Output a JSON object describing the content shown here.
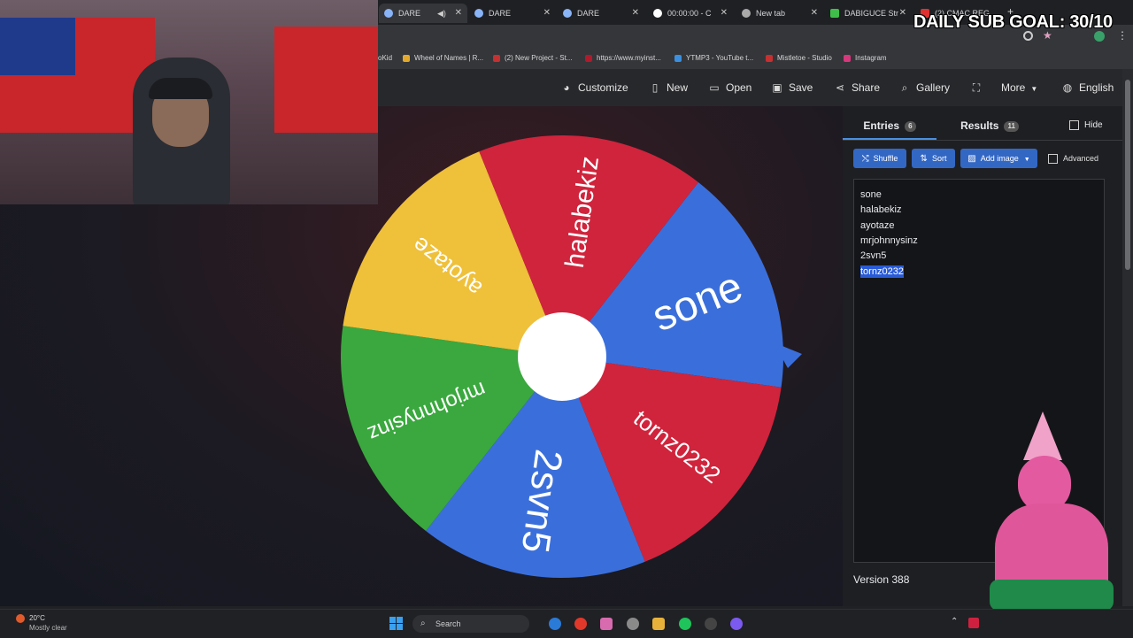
{
  "browser": {
    "tabs": [
      {
        "title": "DARE",
        "active": true
      },
      {
        "title": "DARE",
        "active": false
      },
      {
        "title": "DARE",
        "active": false
      },
      {
        "title": "00:00:00 - C",
        "active": false
      },
      {
        "title": "New tab",
        "active": false
      },
      {
        "title": "DABIGUCE Str",
        "active": false
      },
      {
        "title": "(2) CMAC REG",
        "active": false
      }
    ],
    "bookmarks": [
      "oKid",
      "Wheel of Names | R...",
      "(2) New Project - St...",
      "https://www.myinst...",
      "YTMP3 - YouTube t...",
      "Mistletoe - Studio",
      "Instagram"
    ]
  },
  "toolbar": {
    "customize": "Customize",
    "new": "New",
    "open": "Open",
    "save": "Save",
    "share": "Share",
    "gallery": "Gallery",
    "more": "More",
    "language": "English"
  },
  "wheel": {
    "segments": [
      {
        "label": "sone",
        "color": "#3a6fdb"
      },
      {
        "label": "tornz0232",
        "color": "#d0243c"
      },
      {
        "label": "2svn5",
        "color": "#3a6fdb"
      },
      {
        "label": "mrjohnnysinz",
        "color": "#3aa83e"
      },
      {
        "label": "ayotaze",
        "color": "#efc03a"
      },
      {
        "label": "halabekiz",
        "color": "#d0243c"
      }
    ],
    "pointer_color": "#3a6fdb",
    "hub_color": "#ffffff"
  },
  "sidebar": {
    "entries_tab": "Entries",
    "entries_count": "6",
    "results_tab": "Results",
    "results_count": "11",
    "hide_label": "Hide",
    "shuffle": "Shuffle",
    "sort": "Sort",
    "add_image": "Add image",
    "advanced": "Advanced",
    "entries": [
      "sone",
      "halabekiz",
      "ayotaze",
      "mrjohnnysinz",
      "2svn5",
      "tornz0232"
    ],
    "version": "Version 388"
  },
  "overlay": {
    "subgoal": "DAILY SUB GOAL: 30/10"
  },
  "taskbar": {
    "temp": "20°C",
    "weather": "Mostly clear",
    "search": "Search"
  }
}
